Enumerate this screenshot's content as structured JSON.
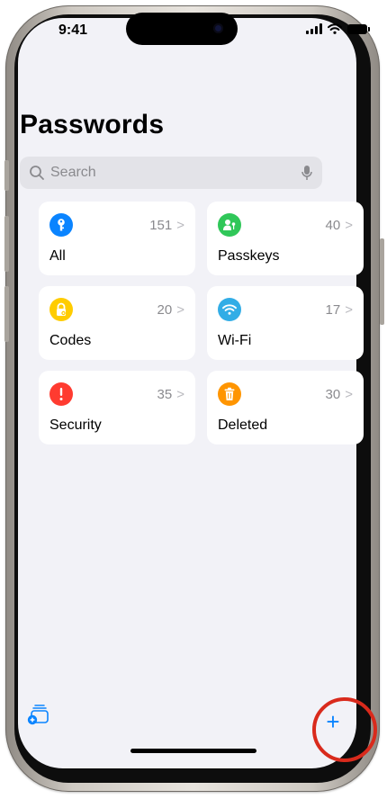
{
  "status_bar": {
    "time": "9:41"
  },
  "header": {
    "title": "Passwords"
  },
  "search": {
    "placeholder": "Search"
  },
  "categories": [
    {
      "label": "All",
      "count": "151",
      "color": "#0a84ff",
      "icon": "key-icon"
    },
    {
      "label": "Passkeys",
      "count": "40",
      "color": "#30c759",
      "icon": "person-key-icon"
    },
    {
      "label": "Codes",
      "count": "20",
      "color": "#ffcc00",
      "icon": "lock-code-icon"
    },
    {
      "label": "Wi-Fi",
      "count": "17",
      "color": "#32ade6",
      "icon": "wifi-icon"
    },
    {
      "label": "Security",
      "count": "35",
      "color": "#ff3b30",
      "icon": "exclamation-icon"
    },
    {
      "label": "Deleted",
      "count": "30",
      "color": "#ff9500",
      "icon": "trash-icon"
    }
  ],
  "chevron": ">",
  "toolbar": {
    "add_label": "+"
  },
  "colors": {
    "accent": "#0a84ff",
    "highlight": "#d92a1c",
    "background": "#f2f2f7"
  }
}
